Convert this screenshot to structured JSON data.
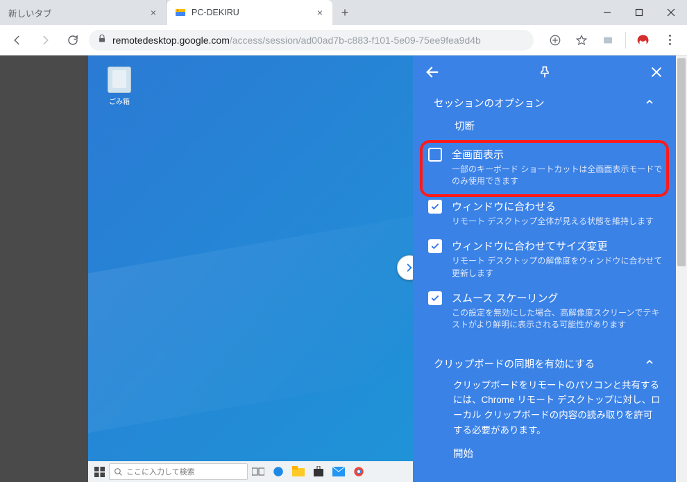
{
  "browser": {
    "tabs": [
      {
        "title": "新しいタブ",
        "active": false
      },
      {
        "title": "PC-DEKIRU",
        "active": true
      }
    ],
    "url_host": "remotedesktop.google.com",
    "url_path": "/access/session/ad00ad7b-c883-f101-5e09-75ee9fea9d4b"
  },
  "desktop": {
    "icon_label": "ごみ箱",
    "search_placeholder": "ここに入力して検索"
  },
  "panel": {
    "section_title": "セッションのオプション",
    "disconnect": "切断",
    "options": [
      {
        "checked": false,
        "title": "全画面表示",
        "desc": "一部のキーボード ショートカットは全画面表示モードでのみ使用できます"
      },
      {
        "checked": true,
        "title": "ウィンドウに合わせる",
        "desc": "リモート デスクトップ全体が見える状態を維持します"
      },
      {
        "checked": true,
        "title": "ウィンドウに合わせてサイズ変更",
        "desc": "リモート デスクトップの解像度をウィンドウに合わせて更新します"
      },
      {
        "checked": true,
        "title": "スムース スケーリング",
        "desc": "この設定を無効にした場合、高解像度スクリーンでテキストがより鮮明に表示される可能性があります"
      }
    ],
    "clipboard_title": "クリップボードの同期を有効にする",
    "clipboard_text": "クリップボードをリモートのパソコンと共有するには、Chrome リモート デスクトップに対し、ローカル クリップボードの内容の読み取りを許可する必要があります。",
    "begin": "開始"
  }
}
